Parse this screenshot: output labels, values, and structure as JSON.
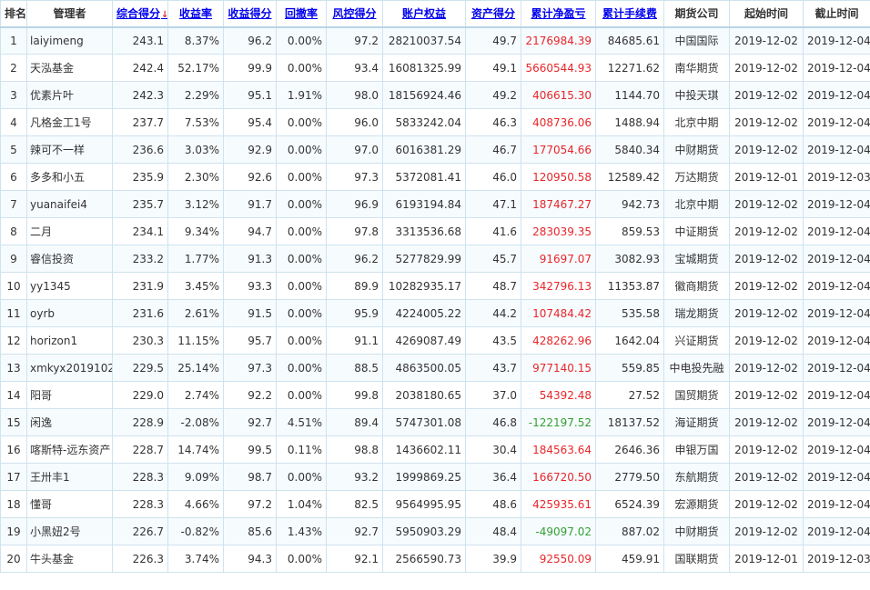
{
  "headers": [
    {
      "label": "排名",
      "sortable": false
    },
    {
      "label": "管理者",
      "sortable": false
    },
    {
      "label": "综合得分",
      "sortable": true,
      "arrow": "↓"
    },
    {
      "label": "收益率",
      "sortable": true
    },
    {
      "label": "收益得分",
      "sortable": true
    },
    {
      "label": "回撤率",
      "sortable": true
    },
    {
      "label": "风控得分",
      "sortable": true
    },
    {
      "label": "账户权益",
      "sortable": true
    },
    {
      "label": "资产得分",
      "sortable": true
    },
    {
      "label": "累计净盈亏",
      "sortable": true
    },
    {
      "label": "累计手续费",
      "sortable": true
    },
    {
      "label": "期货公司",
      "sortable": false
    },
    {
      "label": "起始时间",
      "sortable": false
    },
    {
      "label": "截止时间",
      "sortable": false
    }
  ],
  "rows": [
    {
      "rank": "1",
      "manager": "laiyimeng",
      "score": "243.1",
      "return_rate": "8.37%",
      "return_score": "96.2",
      "drawdown": "0.00%",
      "risk_score": "97.2",
      "equity": "28210037.54",
      "asset_score": "49.7",
      "net_pnl": "2176984.39",
      "pnl_sign": "pos",
      "fees": "84685.61",
      "broker": "中国国际",
      "start": "2019-12-02",
      "end": "2019-12-04"
    },
    {
      "rank": "2",
      "manager": "天泓基金",
      "score": "242.4",
      "return_rate": "52.17%",
      "return_score": "99.9",
      "drawdown": "0.00%",
      "risk_score": "93.4",
      "equity": "16081325.99",
      "asset_score": "49.1",
      "net_pnl": "5660544.93",
      "pnl_sign": "pos",
      "fees": "12271.62",
      "broker": "南华期货",
      "start": "2019-12-02",
      "end": "2019-12-04"
    },
    {
      "rank": "3",
      "manager": "优素片叶",
      "score": "242.3",
      "return_rate": "2.29%",
      "return_score": "95.1",
      "drawdown": "1.91%",
      "risk_score": "98.0",
      "equity": "18156924.46",
      "asset_score": "49.2",
      "net_pnl": "406615.30",
      "pnl_sign": "pos",
      "fees": "1144.70",
      "broker": "中投天琪",
      "start": "2019-12-02",
      "end": "2019-12-04"
    },
    {
      "rank": "4",
      "manager": "凡格金工1号",
      "score": "237.7",
      "return_rate": "7.53%",
      "return_score": "95.4",
      "drawdown": "0.00%",
      "risk_score": "96.0",
      "equity": "5833242.04",
      "asset_score": "46.3",
      "net_pnl": "408736.06",
      "pnl_sign": "pos",
      "fees": "1488.94",
      "broker": "北京中期",
      "start": "2019-12-02",
      "end": "2019-12-04"
    },
    {
      "rank": "5",
      "manager": "辣可不一样",
      "score": "236.6",
      "return_rate": "3.03%",
      "return_score": "92.9",
      "drawdown": "0.00%",
      "risk_score": "97.0",
      "equity": "6016381.29",
      "asset_score": "46.7",
      "net_pnl": "177054.66",
      "pnl_sign": "pos",
      "fees": "5840.34",
      "broker": "中财期货",
      "start": "2019-12-02",
      "end": "2019-12-04"
    },
    {
      "rank": "6",
      "manager": "多多和小五",
      "score": "235.9",
      "return_rate": "2.30%",
      "return_score": "92.6",
      "drawdown": "0.00%",
      "risk_score": "97.3",
      "equity": "5372081.41",
      "asset_score": "46.0",
      "net_pnl": "120950.58",
      "pnl_sign": "pos",
      "fees": "12589.42",
      "broker": "万达期货",
      "start": "2019-12-01",
      "end": "2019-12-03"
    },
    {
      "rank": "7",
      "manager": "yuanaifei4",
      "score": "235.7",
      "return_rate": "3.12%",
      "return_score": "91.7",
      "drawdown": "0.00%",
      "risk_score": "96.9",
      "equity": "6193194.84",
      "asset_score": "47.1",
      "net_pnl": "187467.27",
      "pnl_sign": "pos",
      "fees": "942.73",
      "broker": "北京中期",
      "start": "2019-12-02",
      "end": "2019-12-04"
    },
    {
      "rank": "8",
      "manager": "二月",
      "score": "234.1",
      "return_rate": "9.34%",
      "return_score": "94.7",
      "drawdown": "0.00%",
      "risk_score": "97.8",
      "equity": "3313536.68",
      "asset_score": "41.6",
      "net_pnl": "283039.35",
      "pnl_sign": "pos",
      "fees": "859.53",
      "broker": "中证期货",
      "start": "2019-12-02",
      "end": "2019-12-04"
    },
    {
      "rank": "9",
      "manager": "睿信投资",
      "score": "233.2",
      "return_rate": "1.77%",
      "return_score": "91.3",
      "drawdown": "0.00%",
      "risk_score": "96.2",
      "equity": "5277829.99",
      "asset_score": "45.7",
      "net_pnl": "91697.07",
      "pnl_sign": "pos",
      "fees": "3082.93",
      "broker": "宝城期货",
      "start": "2019-12-02",
      "end": "2019-12-04"
    },
    {
      "rank": "10",
      "manager": "yy1345",
      "score": "231.9",
      "return_rate": "3.45%",
      "return_score": "93.3",
      "drawdown": "0.00%",
      "risk_score": "89.9",
      "equity": "10282935.17",
      "asset_score": "48.7",
      "net_pnl": "342796.13",
      "pnl_sign": "pos",
      "fees": "11353.87",
      "broker": "徽商期货",
      "start": "2019-12-02",
      "end": "2019-12-04"
    },
    {
      "rank": "11",
      "manager": "oyrb",
      "score": "231.6",
      "return_rate": "2.61%",
      "return_score": "91.5",
      "drawdown": "0.00%",
      "risk_score": "95.9",
      "equity": "4224005.22",
      "asset_score": "44.2",
      "net_pnl": "107484.42",
      "pnl_sign": "pos",
      "fees": "535.58",
      "broker": "瑞龙期货",
      "start": "2019-12-02",
      "end": "2019-12-04"
    },
    {
      "rank": "12",
      "manager": "horizon1",
      "score": "230.3",
      "return_rate": "11.15%",
      "return_score": "95.7",
      "drawdown": "0.00%",
      "risk_score": "91.1",
      "equity": "4269087.49",
      "asset_score": "43.5",
      "net_pnl": "428262.96",
      "pnl_sign": "pos",
      "fees": "1642.04",
      "broker": "兴证期货",
      "start": "2019-12-02",
      "end": "2019-12-04"
    },
    {
      "rank": "13",
      "manager": "xmkyx2019102",
      "score": "229.5",
      "return_rate": "25.14%",
      "return_score": "97.3",
      "drawdown": "0.00%",
      "risk_score": "88.5",
      "equity": "4863500.05",
      "asset_score": "43.7",
      "net_pnl": "977140.15",
      "pnl_sign": "pos",
      "fees": "559.85",
      "broker": "中电投先融",
      "start": "2019-12-02",
      "end": "2019-12-04"
    },
    {
      "rank": "14",
      "manager": "阳哥",
      "score": "229.0",
      "return_rate": "2.74%",
      "return_score": "92.2",
      "drawdown": "0.00%",
      "risk_score": "99.8",
      "equity": "2038180.65",
      "asset_score": "37.0",
      "net_pnl": "54392.48",
      "pnl_sign": "pos",
      "fees": "27.52",
      "broker": "国贸期货",
      "start": "2019-12-02",
      "end": "2019-12-04"
    },
    {
      "rank": "15",
      "manager": "闲逸",
      "score": "228.9",
      "return_rate": "-2.08%",
      "return_score": "92.7",
      "drawdown": "4.51%",
      "risk_score": "89.4",
      "equity": "5747301.08",
      "asset_score": "46.8",
      "net_pnl": "-122197.52",
      "pnl_sign": "neg",
      "fees": "18137.52",
      "broker": "海证期货",
      "start": "2019-12-02",
      "end": "2019-12-04"
    },
    {
      "rank": "16",
      "manager": "喀斯特-远东资产",
      "score": "228.7",
      "return_rate": "14.74%",
      "return_score": "99.5",
      "drawdown": "0.11%",
      "risk_score": "98.8",
      "equity": "1436602.11",
      "asset_score": "30.4",
      "net_pnl": "184563.64",
      "pnl_sign": "pos",
      "fees": "2646.36",
      "broker": "申银万国",
      "start": "2019-12-02",
      "end": "2019-12-04"
    },
    {
      "rank": "17",
      "manager": "王卅丰1",
      "score": "228.3",
      "return_rate": "9.09%",
      "return_score": "98.7",
      "drawdown": "0.00%",
      "risk_score": "93.2",
      "equity": "1999869.25",
      "asset_score": "36.4",
      "net_pnl": "166720.50",
      "pnl_sign": "pos",
      "fees": "2779.50",
      "broker": "东航期货",
      "start": "2019-12-02",
      "end": "2019-12-04"
    },
    {
      "rank": "18",
      "manager": "懂哥",
      "score": "228.3",
      "return_rate": "4.66%",
      "return_score": "97.2",
      "drawdown": "1.04%",
      "risk_score": "82.5",
      "equity": "9564995.95",
      "asset_score": "48.6",
      "net_pnl": "425935.61",
      "pnl_sign": "pos",
      "fees": "6524.39",
      "broker": "宏源期货",
      "start": "2019-12-02",
      "end": "2019-12-04"
    },
    {
      "rank": "19",
      "manager": "小黑妞2号",
      "score": "226.7",
      "return_rate": "-0.82%",
      "return_score": "85.6",
      "drawdown": "1.43%",
      "risk_score": "92.7",
      "equity": "5950903.29",
      "asset_score": "48.4",
      "net_pnl": "-49097.02",
      "pnl_sign": "neg",
      "fees": "887.02",
      "broker": "中财期货",
      "start": "2019-12-02",
      "end": "2019-12-04"
    },
    {
      "rank": "20",
      "manager": "牛头基金",
      "score": "226.3",
      "return_rate": "3.74%",
      "return_score": "94.3",
      "drawdown": "0.00%",
      "risk_score": "92.1",
      "equity": "2566590.73",
      "asset_score": "39.9",
      "net_pnl": "92550.09",
      "pnl_sign": "pos",
      "fees": "459.91",
      "broker": "国联期货",
      "start": "2019-12-01",
      "end": "2019-12-03"
    }
  ],
  "colors": {
    "link": "#0000ee",
    "positive": "#e8262a",
    "negative": "#33a033",
    "border": "#cfe3ef",
    "stripe": "#f6fbfe"
  }
}
